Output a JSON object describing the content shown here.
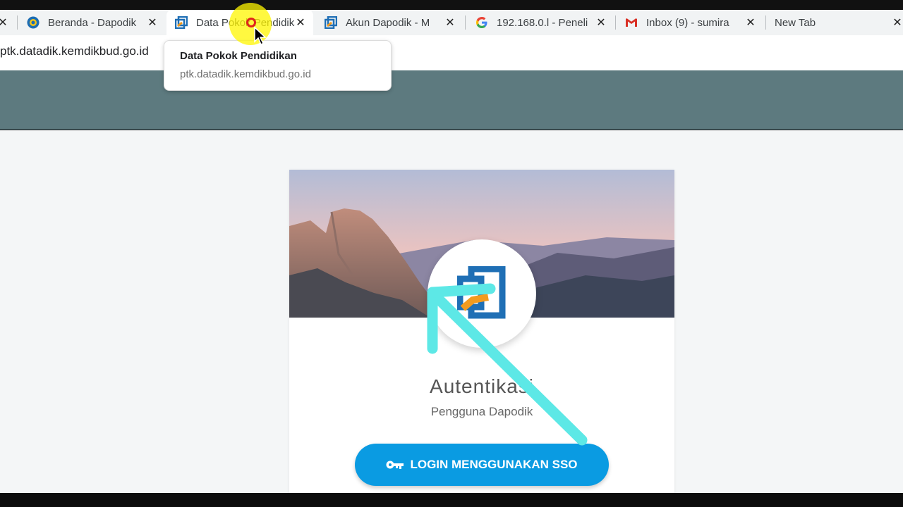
{
  "browser": {
    "tabs": [
      {
        "title": "Beranda - Dapodik",
        "icon": "tutwuri-icon",
        "active": false
      },
      {
        "title": "Data Pokok Pendidikan",
        "icon": "dapodik-icon",
        "active": true
      },
      {
        "title": "Akun Dapodik - M",
        "icon": "dapodik-icon",
        "active": false
      },
      {
        "title": "192.168.0.l - Peneli",
        "icon": "google-icon",
        "active": false
      },
      {
        "title": "Inbox (9) - sumira",
        "icon": "gmail-icon",
        "active": false
      },
      {
        "title": "New Tab",
        "icon": "",
        "active": false
      }
    ],
    "close_glyph": "✕",
    "url": "ptk.datadik.kemdikbud.go.id",
    "tooltip": {
      "title": "Data Pokok Pendidikan",
      "url": "ptk.datadik.kemdikbud.go.id"
    }
  },
  "card": {
    "title": "Autentikasi",
    "subtitle": "Pengguna Dapodik",
    "login_button": "LOGIN MENGGUNAKAN SSO",
    "login_icon": "key-icon"
  },
  "colors": {
    "header_band": "#5d7a7f",
    "button": "#0a9be2",
    "annotation": "#5de8e6",
    "logo_blue": "#1f6fb5",
    "logo_orange": "#f29b1f"
  }
}
